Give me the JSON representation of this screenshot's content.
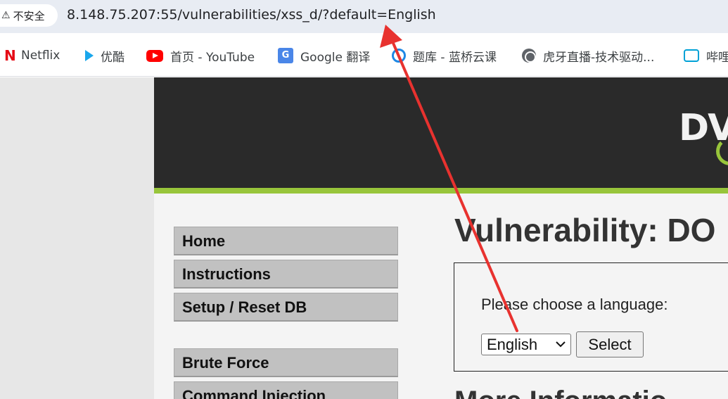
{
  "browser": {
    "security_label": "不安全",
    "url": "8.148.75.207:55/vulnerabilities/xss_d/?default=English"
  },
  "bookmarks": [
    {
      "label": "Netflix",
      "icon": "netflix-icon"
    },
    {
      "label": "优酷",
      "icon": "youku-icon"
    },
    {
      "label": "首页 - YouTube",
      "icon": "youtube-icon"
    },
    {
      "label": "Google 翻译",
      "icon": "google-translate-icon"
    },
    {
      "label": "题库 - 蓝桥云课",
      "icon": "lanqiao-icon"
    },
    {
      "label": "虎牙直播-技术驱动...",
      "icon": "globe-icon"
    },
    {
      "label": "哔哩",
      "icon": "bilibili-icon"
    }
  ],
  "logo": {
    "text": "DV"
  },
  "menu": [
    {
      "label": "Home"
    },
    {
      "label": "Instructions"
    },
    {
      "label": "Setup / Reset DB"
    },
    {
      "label": "Brute Force"
    },
    {
      "label": "Command Injection"
    }
  ],
  "main": {
    "title": "Vulnerability: DO",
    "choose_label": "Please choose a language:",
    "selected_language": "English",
    "select_button": "Select",
    "more_info": "More Informatio"
  },
  "colors": {
    "header_bg": "#2a2a2a",
    "accent_green": "#98c53b",
    "annotation_arrow": "#e8322f"
  }
}
